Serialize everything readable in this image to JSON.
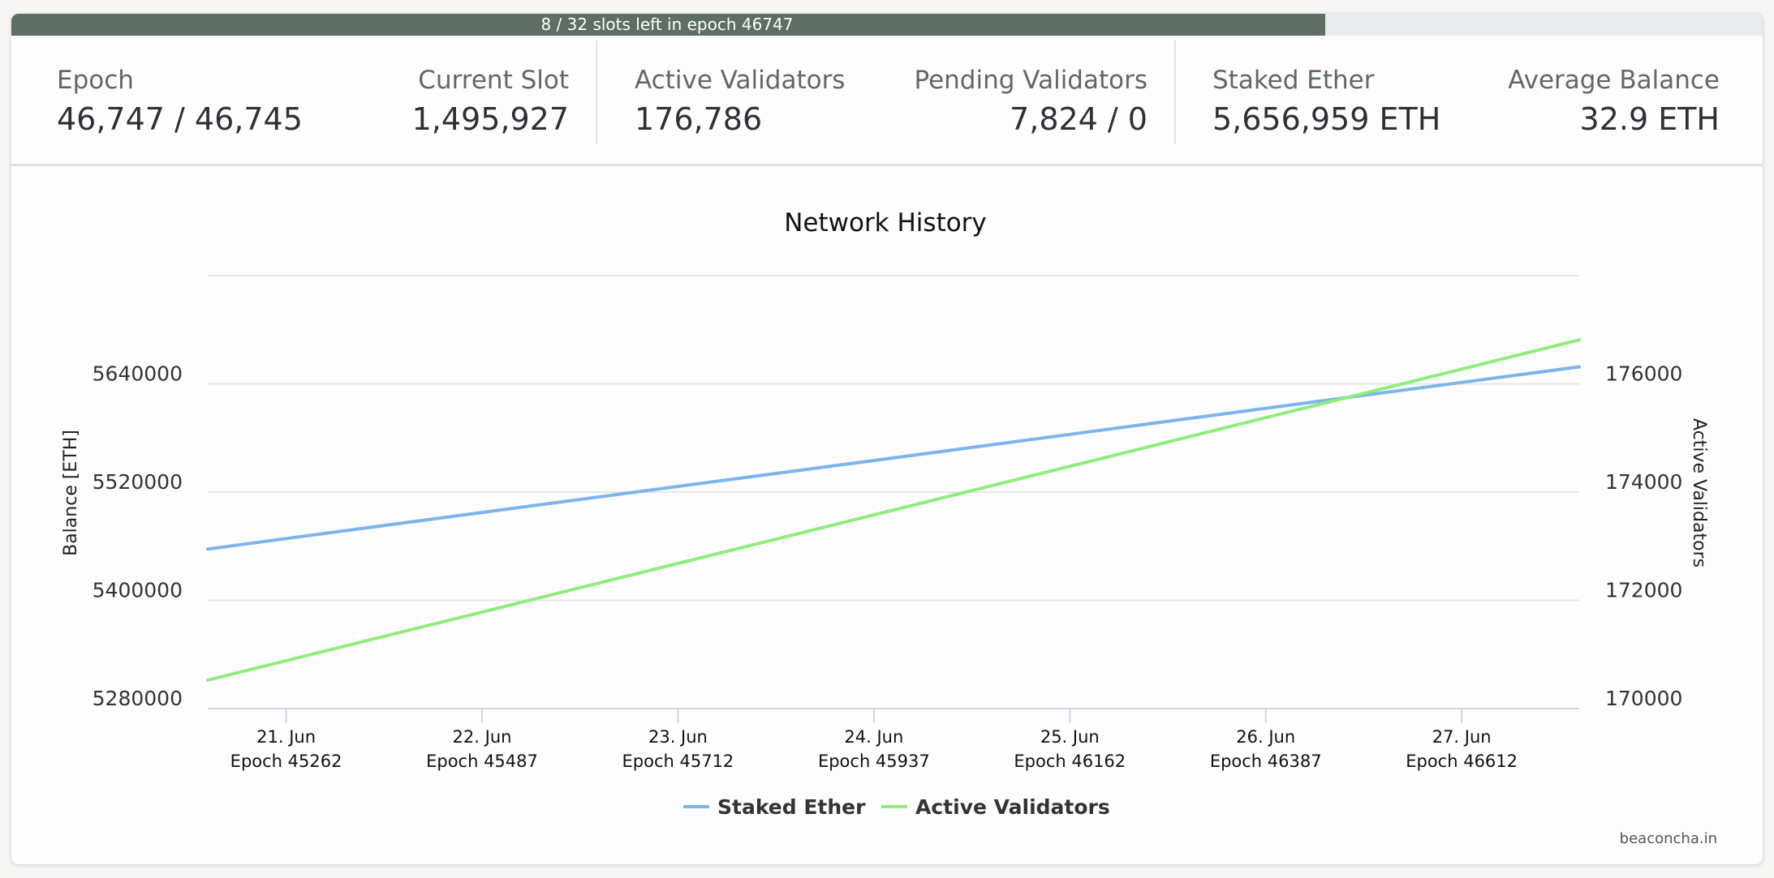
{
  "progress": {
    "label": "8 / 32 slots left in epoch 46747",
    "fraction_elapsed": 0.75,
    "fill_color": "#5e6e64"
  },
  "stats": [
    {
      "label": "Epoch",
      "value": "46,747 / 46,745"
    },
    {
      "label": "Current Slot",
      "value": "1,495,927"
    },
    {
      "label": "Active Validators",
      "value": "176,786"
    },
    {
      "label": "Pending Validators",
      "value": "7,824 / 0"
    },
    {
      "label": "Staked Ether",
      "value": "5,656,959 ETH"
    },
    {
      "label": "Average Balance",
      "value": "32.9 ETH"
    }
  ],
  "chart_data": {
    "type": "line",
    "title": "Network History",
    "credit": "beaconcha.in",
    "x_ticks": [
      {
        "date": "21. Jun",
        "epoch": "Epoch 45262"
      },
      {
        "date": "22. Jun",
        "epoch": "Epoch 45487"
      },
      {
        "date": "23. Jun",
        "epoch": "Epoch 45712"
      },
      {
        "date": "24. Jun",
        "epoch": "Epoch 45937"
      },
      {
        "date": "25. Jun",
        "epoch": "Epoch 46162"
      },
      {
        "date": "26. Jun",
        "epoch": "Epoch 46387"
      },
      {
        "date": "27. Jun",
        "epoch": "Epoch 46612"
      }
    ],
    "x_range_days": [
      20.6,
      27.6
    ],
    "x_tick_days": [
      21,
      22,
      23,
      24,
      25,
      26,
      27
    ],
    "y_left": {
      "label": "Balance [ETH]",
      "range": [
        5280000,
        5760000
      ],
      "ticks": [
        5280000,
        5400000,
        5520000,
        5640000
      ],
      "tick_labels": [
        "5280000",
        "5400000",
        "5520000",
        "5640000"
      ]
    },
    "y_right": {
      "label": "Active Validators",
      "range": [
        170000,
        178000
      ],
      "ticks": [
        170000,
        172000,
        174000,
        176000
      ],
      "tick_labels": [
        "170000",
        "172000",
        "174000",
        "176000"
      ]
    },
    "grid": true,
    "legend_position": "bottom-center",
    "series": [
      {
        "name": "Staked Ether",
        "axis": "left",
        "color": "#7cb5ec",
        "points": [
          [
            20.6,
            5456800
          ],
          [
            21,
            5468500
          ],
          [
            22,
            5497400
          ],
          [
            23,
            5526300
          ],
          [
            24,
            5555100
          ],
          [
            25,
            5584000
          ],
          [
            26,
            5612900
          ],
          [
            27,
            5641600
          ],
          [
            27.6,
            5658900
          ]
        ]
      },
      {
        "name": "Active Validators",
        "axis": "right",
        "color": "#90ed7d",
        "points": [
          [
            20.6,
            170526
          ],
          [
            21,
            170885
          ],
          [
            22,
            171783
          ],
          [
            23,
            172681
          ],
          [
            24,
            173579
          ],
          [
            25,
            174477
          ],
          [
            26,
            175375
          ],
          [
            27,
            176273
          ],
          [
            27.6,
            176812
          ]
        ]
      }
    ]
  }
}
